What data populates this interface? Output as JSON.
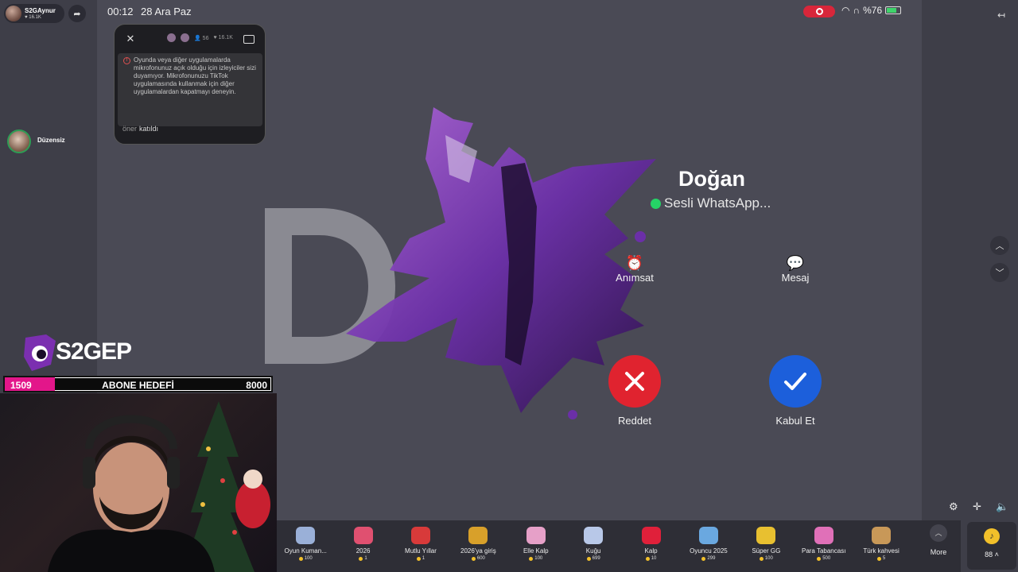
{
  "host": {
    "name": "S2GAynur",
    "likes": "16.1K"
  },
  "viewer": {
    "name": "Düzensiz"
  },
  "status_bar": {
    "time": "00:12",
    "date": "28 Ara Paz",
    "battery": "%76",
    "battery_level": 0.76
  },
  "overlay": {
    "stat1": "56",
    "stat2": "16.1K",
    "warning": "Oyunda veya diğer uygulamalarda mikrofonunuz açık olduğu için izleyiciler sizi duyamıyor. Mikrofonunuzu TikTok uygulamasında kullanmak için diğer uygulamalardan kapatmayı deneyin.",
    "joined_user": "öner",
    "joined_text": "katıldı"
  },
  "call": {
    "avatar_letter": "D",
    "caller": "Doğan",
    "subtitle": "Sesli WhatsApp...",
    "remind_label": "Anımsat",
    "message_label": "Mesaj",
    "decline_label": "Reddet",
    "accept_label": "Kabul Et"
  },
  "gifts": [
    {
      "name": "Oyun Kuman...",
      "price": "100",
      "color": "#9ab0d8"
    },
    {
      "name": "2026",
      "price": "1",
      "color": "#e05070"
    },
    {
      "name": "Mutlu Yıllar",
      "price": "1",
      "color": "#d83a3a"
    },
    {
      "name": "2026'ya giriş",
      "price": "600",
      "color": "#d8a02a"
    },
    {
      "name": "Elle Kalp",
      "price": "100",
      "color": "#e6a0c8"
    },
    {
      "name": "Kuğu",
      "price": "699",
      "color": "#b8c8e8"
    },
    {
      "name": "Kalp",
      "price": "10",
      "color": "#e0203a"
    },
    {
      "name": "Oyuncu 2025",
      "price": "299",
      "color": "#6aa8e0"
    },
    {
      "name": "Süper GG",
      "price": "100",
      "color": "#e8c030"
    },
    {
      "name": "Para Tabancası",
      "price": "500",
      "color": "#e070b8"
    },
    {
      "name": "Türk kahvesi",
      "price": "5",
      "color": "#c89858"
    }
  ],
  "more_label": "More",
  "wallet": {
    "coins": "88"
  },
  "brand": {
    "logo_text": "S2GEP"
  },
  "goal": {
    "current": "1509",
    "title": "ABONE HEDEFİ",
    "target": "8000",
    "progress": 0.1886
  },
  "colors": {
    "decline": "#e0232f",
    "accept": "#1c5fdb",
    "goal_fill": "#e3168a",
    "record": "#d8263a"
  }
}
